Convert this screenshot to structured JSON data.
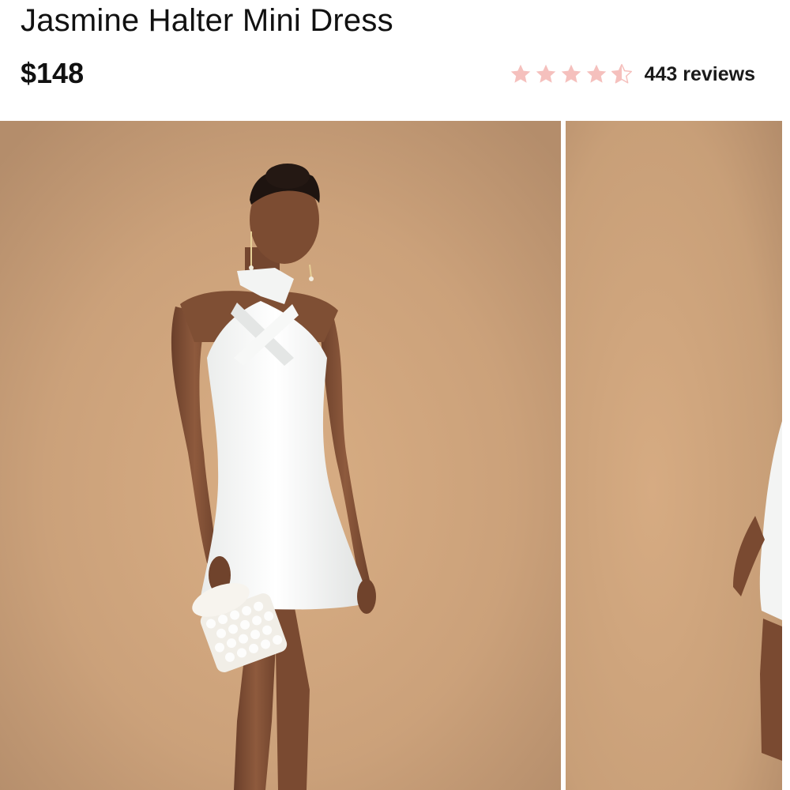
{
  "product": {
    "title": "Jasmine Halter Mini Dress",
    "price": "$148",
    "rating": {
      "value": 4.5,
      "max": 5,
      "reviews_label": "443 reviews",
      "star_color": "#f5c0bd",
      "star_empty_color": "#ffffff"
    }
  },
  "gallery": {
    "images": [
      {
        "name": "product-photo-1",
        "backdrop": "#c9a07a"
      },
      {
        "name": "product-photo-2",
        "backdrop": "#c9a07a"
      }
    ]
  }
}
